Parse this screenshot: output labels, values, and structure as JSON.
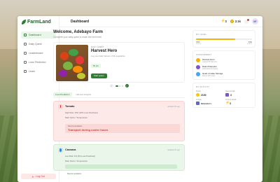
{
  "app": {
    "name": "FarmLand"
  },
  "sidebar": {
    "items": [
      {
        "label": "Dashboard",
        "active": true
      },
      {
        "label": "Daily Quest",
        "active": false
      },
      {
        "label": "Leaderboard",
        "active": false
      },
      {
        "label": "Loss Prediction",
        "active": false
      },
      {
        "label": "Learn",
        "active": false
      }
    ],
    "logout_label": "Log Out"
  },
  "header": {
    "title": "Dashboard",
    "streak": "3",
    "coins": "2.1k",
    "avatar_initials": "BF",
    "notifications_dot": true
  },
  "main": {
    "welcome": "Welcome, Adebayo Farm",
    "subtitle": "Complete your daily quest to reach the next level",
    "quest": {
      "kicker": "DAILY QUEST",
      "title": "Harvest Hero",
      "description": "Log your daily harvest of 30 vegetables",
      "reward": "50 pts",
      "start_label": "Start quest"
    },
    "tabs": [
      "Loss Prediction",
      "Harvest Insights"
    ],
    "active_tab": 0,
    "crops": [
      {
        "name": "Tomato",
        "time": "updated 3h ago",
        "risk": "High Risk: 15% (20% Loss Predicted)",
        "factor": "Main Factor: Temperature",
        "recommendation_label": "Recommendation",
        "recommendation": "Transport during cooler hours",
        "tone": "red"
      },
      {
        "name": "Cassava",
        "time": "updated 3h ago",
        "risk": "Low Risk: 4% (5% Loss Predicted)",
        "factor": "Main Factor: Temperature",
        "recommendation_label": "Recommendation",
        "recommendation": "",
        "tone": "green"
      }
    ]
  },
  "right": {
    "level": {
      "title": "MY LEVEL",
      "progress": 0.7,
      "current": "1500",
      "next": "3000",
      "current_label": "Level 3",
      "next_label": "Level 4"
    },
    "achievements": {
      "title": "ACHIEVEMENT",
      "items": [
        {
          "name": "Harvest Hero",
          "desc": "Logged 50 harvests",
          "color": "#f2b705"
        },
        {
          "name": "Data Champion",
          "desc": "Submitted 20 reports",
          "color": "#7e57c2"
        },
        {
          "name": "Heart of state Storage",
          "desc": "Stored 100 crops",
          "color": "#42a5f5"
        }
      ]
    },
    "activity": {
      "title": "MY ACTIVITY",
      "items": [
        {
          "label": "Points",
          "value": "2100",
          "color": "#f5c518"
        },
        {
          "label": "Quest streak",
          "value": "3",
          "color": "#7e57c2"
        },
        {
          "label": "League",
          "value": "Harvester L",
          "color": "#5c6bc0"
        },
        {
          "label": "Current streak",
          "value": "3",
          "color": "#f2b705"
        }
      ]
    }
  },
  "colors": {
    "brand": "#2e7d32",
    "danger": "#d33c3c",
    "gold": "#f2b705"
  }
}
